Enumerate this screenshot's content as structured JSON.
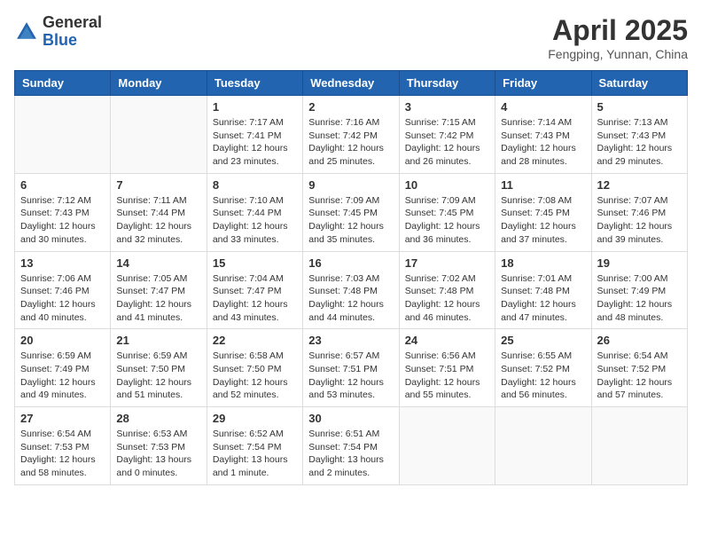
{
  "header": {
    "logo_general": "General",
    "logo_blue": "Blue",
    "month_title": "April 2025",
    "location": "Fengping, Yunnan, China"
  },
  "weekdays": [
    "Sunday",
    "Monday",
    "Tuesday",
    "Wednesday",
    "Thursday",
    "Friday",
    "Saturday"
  ],
  "weeks": [
    [
      {
        "day": "",
        "detail": ""
      },
      {
        "day": "",
        "detail": ""
      },
      {
        "day": "1",
        "detail": "Sunrise: 7:17 AM\nSunset: 7:41 PM\nDaylight: 12 hours and 23 minutes."
      },
      {
        "day": "2",
        "detail": "Sunrise: 7:16 AM\nSunset: 7:42 PM\nDaylight: 12 hours and 25 minutes."
      },
      {
        "day": "3",
        "detail": "Sunrise: 7:15 AM\nSunset: 7:42 PM\nDaylight: 12 hours and 26 minutes."
      },
      {
        "day": "4",
        "detail": "Sunrise: 7:14 AM\nSunset: 7:43 PM\nDaylight: 12 hours and 28 minutes."
      },
      {
        "day": "5",
        "detail": "Sunrise: 7:13 AM\nSunset: 7:43 PM\nDaylight: 12 hours and 29 minutes."
      }
    ],
    [
      {
        "day": "6",
        "detail": "Sunrise: 7:12 AM\nSunset: 7:43 PM\nDaylight: 12 hours and 30 minutes."
      },
      {
        "day": "7",
        "detail": "Sunrise: 7:11 AM\nSunset: 7:44 PM\nDaylight: 12 hours and 32 minutes."
      },
      {
        "day": "8",
        "detail": "Sunrise: 7:10 AM\nSunset: 7:44 PM\nDaylight: 12 hours and 33 minutes."
      },
      {
        "day": "9",
        "detail": "Sunrise: 7:09 AM\nSunset: 7:45 PM\nDaylight: 12 hours and 35 minutes."
      },
      {
        "day": "10",
        "detail": "Sunrise: 7:09 AM\nSunset: 7:45 PM\nDaylight: 12 hours and 36 minutes."
      },
      {
        "day": "11",
        "detail": "Sunrise: 7:08 AM\nSunset: 7:45 PM\nDaylight: 12 hours and 37 minutes."
      },
      {
        "day": "12",
        "detail": "Sunrise: 7:07 AM\nSunset: 7:46 PM\nDaylight: 12 hours and 39 minutes."
      }
    ],
    [
      {
        "day": "13",
        "detail": "Sunrise: 7:06 AM\nSunset: 7:46 PM\nDaylight: 12 hours and 40 minutes."
      },
      {
        "day": "14",
        "detail": "Sunrise: 7:05 AM\nSunset: 7:47 PM\nDaylight: 12 hours and 41 minutes."
      },
      {
        "day": "15",
        "detail": "Sunrise: 7:04 AM\nSunset: 7:47 PM\nDaylight: 12 hours and 43 minutes."
      },
      {
        "day": "16",
        "detail": "Sunrise: 7:03 AM\nSunset: 7:48 PM\nDaylight: 12 hours and 44 minutes."
      },
      {
        "day": "17",
        "detail": "Sunrise: 7:02 AM\nSunset: 7:48 PM\nDaylight: 12 hours and 46 minutes."
      },
      {
        "day": "18",
        "detail": "Sunrise: 7:01 AM\nSunset: 7:48 PM\nDaylight: 12 hours and 47 minutes."
      },
      {
        "day": "19",
        "detail": "Sunrise: 7:00 AM\nSunset: 7:49 PM\nDaylight: 12 hours and 48 minutes."
      }
    ],
    [
      {
        "day": "20",
        "detail": "Sunrise: 6:59 AM\nSunset: 7:49 PM\nDaylight: 12 hours and 49 minutes."
      },
      {
        "day": "21",
        "detail": "Sunrise: 6:59 AM\nSunset: 7:50 PM\nDaylight: 12 hours and 51 minutes."
      },
      {
        "day": "22",
        "detail": "Sunrise: 6:58 AM\nSunset: 7:50 PM\nDaylight: 12 hours and 52 minutes."
      },
      {
        "day": "23",
        "detail": "Sunrise: 6:57 AM\nSunset: 7:51 PM\nDaylight: 12 hours and 53 minutes."
      },
      {
        "day": "24",
        "detail": "Sunrise: 6:56 AM\nSunset: 7:51 PM\nDaylight: 12 hours and 55 minutes."
      },
      {
        "day": "25",
        "detail": "Sunrise: 6:55 AM\nSunset: 7:52 PM\nDaylight: 12 hours and 56 minutes."
      },
      {
        "day": "26",
        "detail": "Sunrise: 6:54 AM\nSunset: 7:52 PM\nDaylight: 12 hours and 57 minutes."
      }
    ],
    [
      {
        "day": "27",
        "detail": "Sunrise: 6:54 AM\nSunset: 7:53 PM\nDaylight: 12 hours and 58 minutes."
      },
      {
        "day": "28",
        "detail": "Sunrise: 6:53 AM\nSunset: 7:53 PM\nDaylight: 13 hours and 0 minutes."
      },
      {
        "day": "29",
        "detail": "Sunrise: 6:52 AM\nSunset: 7:54 PM\nDaylight: 13 hours and 1 minute."
      },
      {
        "day": "30",
        "detail": "Sunrise: 6:51 AM\nSunset: 7:54 PM\nDaylight: 13 hours and 2 minutes."
      },
      {
        "day": "",
        "detail": ""
      },
      {
        "day": "",
        "detail": ""
      },
      {
        "day": "",
        "detail": ""
      }
    ]
  ]
}
